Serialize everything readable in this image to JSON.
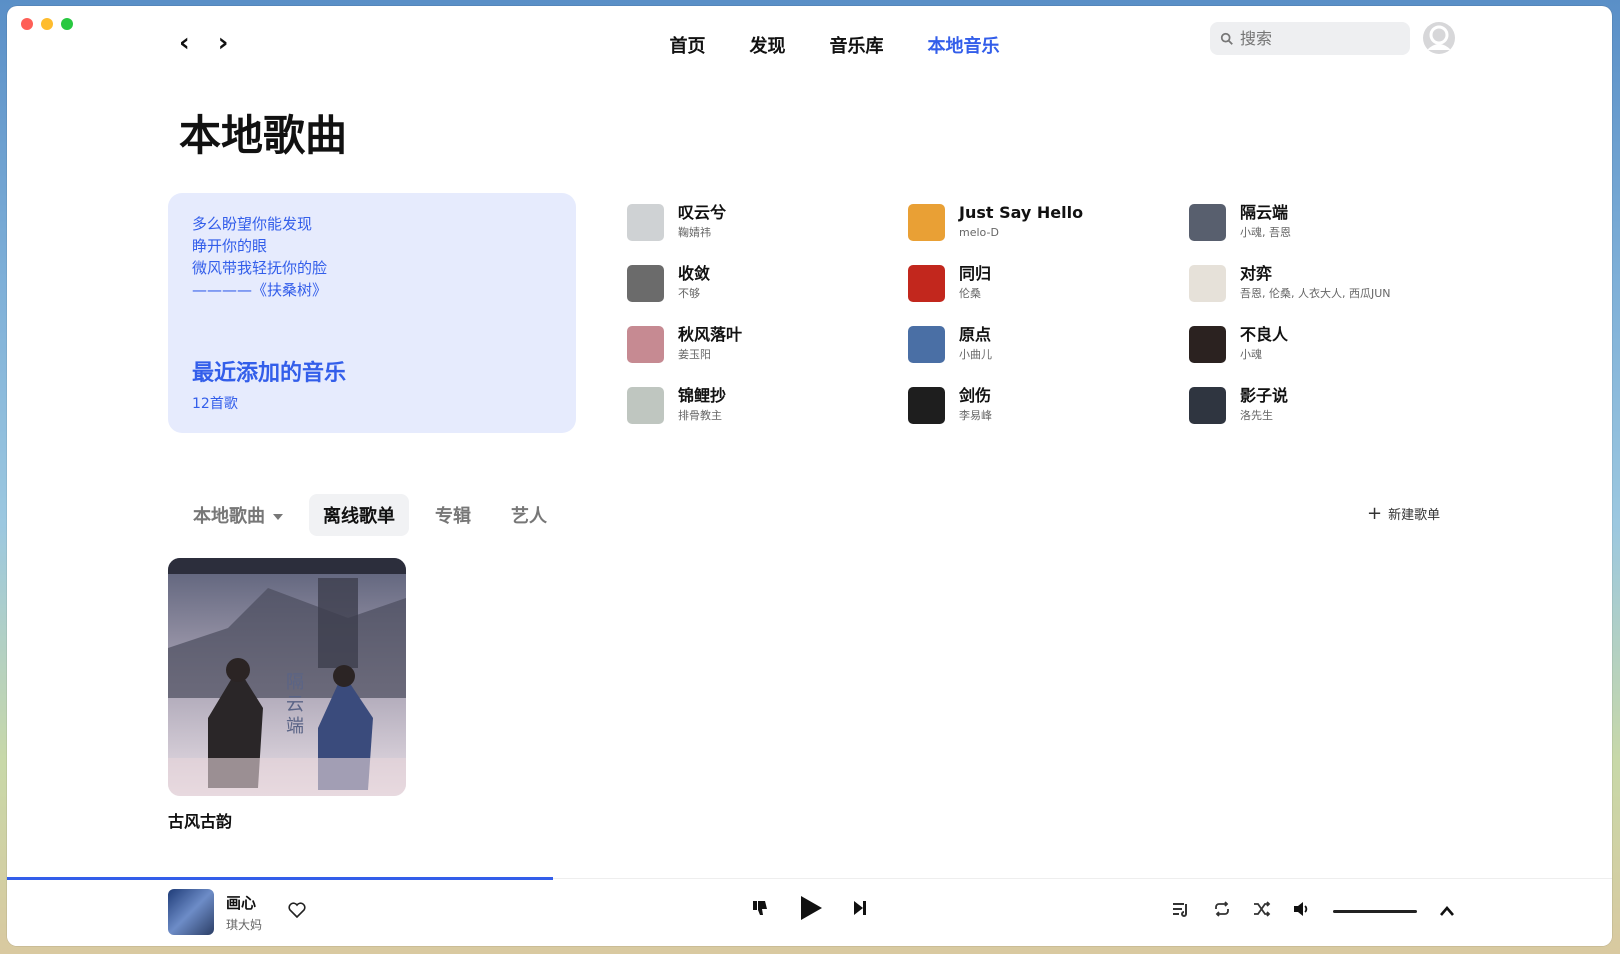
{
  "nav": {
    "tabs": [
      {
        "label": "首页"
      },
      {
        "label": "发现"
      },
      {
        "label": "音乐库"
      },
      {
        "label": "本地音乐"
      }
    ],
    "active_tab": "本地音乐"
  },
  "search": {
    "placeholder": "搜索"
  },
  "page": {
    "title": "本地歌曲"
  },
  "recent": {
    "lyrics": [
      "多么盼望你能发现",
      "睁开你的眼",
      "微风带我轻抚你的脸",
      "————《扶桑树》"
    ],
    "title": "最近添加的音乐",
    "count": "12首歌"
  },
  "tracks": [
    {
      "title": "叹云兮",
      "artist": "鞠婧祎",
      "cover_color": "#cfd2d4"
    },
    {
      "title": "Just Say Hello",
      "artist": "melo-D",
      "cover_color": "#e9a035"
    },
    {
      "title": "隔云端",
      "artist": "小魂, 吾恩",
      "cover_color": "#585f6e"
    },
    {
      "title": "收敛",
      "artist": "不够",
      "cover_color": "#6b6b6b"
    },
    {
      "title": "同归",
      "artist": "伦桑",
      "cover_color": "#c2271d"
    },
    {
      "title": "对弈",
      "artist": "吾恩, 伦桑, 人衣大人, 西瓜JUN",
      "cover_color": "#e6e1d9"
    },
    {
      "title": "秋风落叶",
      "artist": "姜玉阳",
      "cover_color": "#c68a92"
    },
    {
      "title": "原点",
      "artist": "小曲儿",
      "cover_color": "#4a6fa5"
    },
    {
      "title": "不良人",
      "artist": "小魂",
      "cover_color": "#2b2220"
    },
    {
      "title": "锦鲤抄",
      "artist": "排骨教主",
      "cover_color": "#bfc6c0"
    },
    {
      "title": "剑伤",
      "artist": "李易峰",
      "cover_color": "#1e1e1e"
    },
    {
      "title": "影子说",
      "artist": "洛先生",
      "cover_color": "#2f3540"
    }
  ],
  "tabs": {
    "items": [
      {
        "label": "本地歌曲"
      },
      {
        "label": "离线歌单"
      },
      {
        "label": "专辑"
      },
      {
        "label": "艺人"
      }
    ],
    "active": "离线歌单",
    "new_playlist": "新建歌单"
  },
  "playlists": [
    {
      "name": "古风古韵",
      "cover_text": "隔云端"
    }
  ],
  "player": {
    "title": "画心",
    "artist": "琪大妈",
    "progress_fraction": 0.34,
    "volume_fraction": 1.0
  },
  "colors": {
    "accent": "#335eea",
    "card_bg": "#e6ebfd"
  }
}
